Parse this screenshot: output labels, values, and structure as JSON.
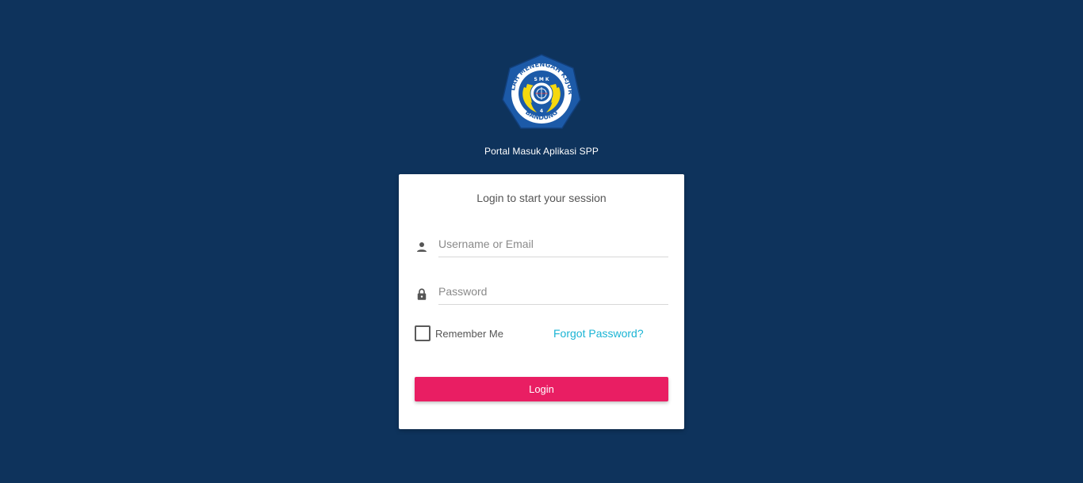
{
  "header": {
    "logo_name": "smk-bandung-logo",
    "logo_text_top": "SEKOLAH MENENGAH KEJURUAN",
    "logo_text_bottom": "BANDUNG",
    "logo_text_inner": "SMK",
    "portal_title": "Portal Masuk Aplikasi SPP"
  },
  "login_card": {
    "title": "Login to start your session",
    "username": {
      "icon": "person-icon",
      "placeholder": "Username or Email",
      "value": ""
    },
    "password": {
      "icon": "lock-icon",
      "placeholder": "Password",
      "value": ""
    },
    "remember_me": {
      "label": "Remember Me",
      "checked": false
    },
    "forgot_password": "Forgot Password?",
    "login_button": "Login"
  },
  "colors": {
    "background": "#0e335c",
    "card": "#ffffff",
    "primary_button": "#e91e63",
    "link": "#1ab4d4",
    "logo_blue": "#1c5aa8",
    "logo_yellow": "#f5d80f"
  }
}
